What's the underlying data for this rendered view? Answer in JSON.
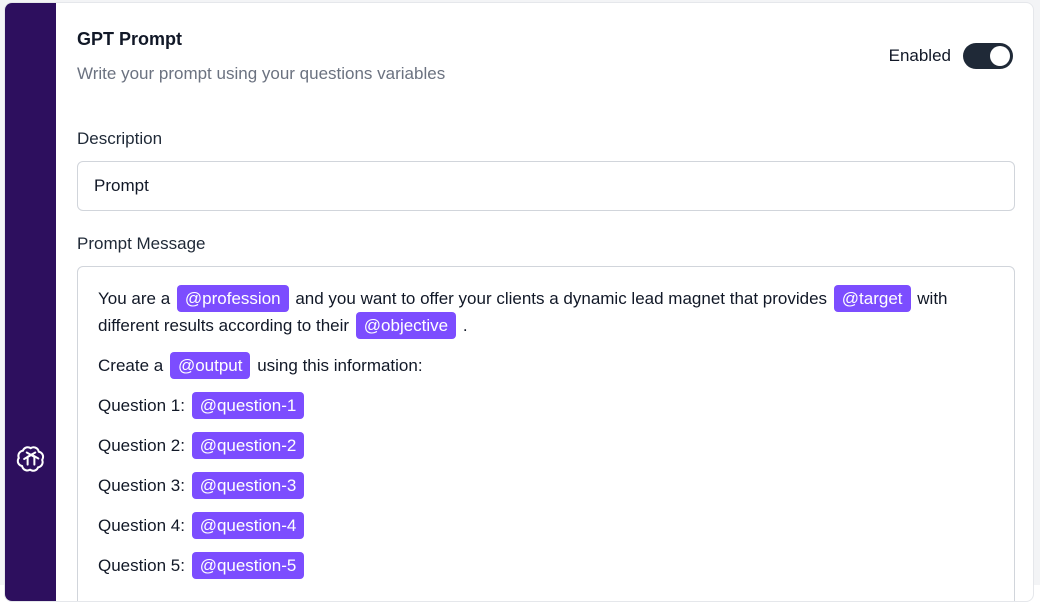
{
  "header": {
    "title": "GPT Prompt",
    "subtitle": "Write your prompt using your questions variables",
    "toggle_label": "Enabled",
    "toggle_on": true
  },
  "description": {
    "label": "Description",
    "value": "Prompt"
  },
  "prompt_message": {
    "label": "Prompt Message",
    "line1": {
      "t1": "You are a",
      "v1": "@profession",
      "t2": "and you want to offer your clients a dynamic lead magnet that provides",
      "v2": "@target",
      "t3": "with different results according to their",
      "v3": "@objective",
      "t4": "."
    },
    "line2": {
      "t1": "Create a",
      "v1": "@output",
      "t2": "using this information:"
    },
    "questions": [
      {
        "label": "Question 1:",
        "var": "@question-1"
      },
      {
        "label": "Question 2:",
        "var": "@question-2"
      },
      {
        "label": "Question 3:",
        "var": "@question-3"
      },
      {
        "label": "Question 4:",
        "var": "@question-4"
      },
      {
        "label": "Question 5:",
        "var": "@question-5"
      }
    ]
  },
  "colors": {
    "rail": "#2d0f5e",
    "tag": "#7c4dff"
  },
  "icons": {
    "rail_logo": "openai-logo-icon"
  }
}
